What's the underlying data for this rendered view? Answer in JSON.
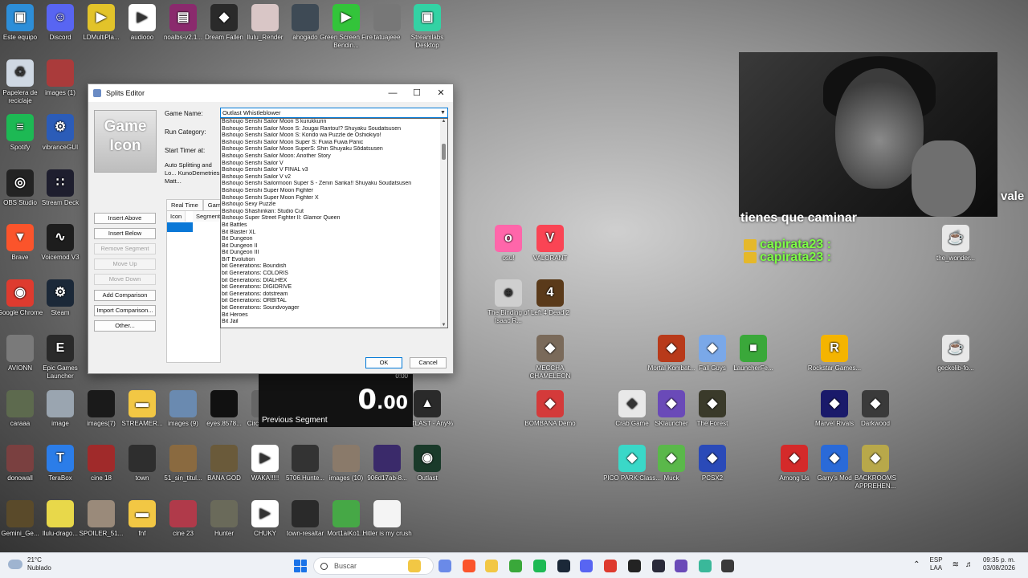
{
  "desktop_icons": [
    {
      "label": "Este equipo",
      "icon": "computer-icon",
      "color": "#2d8ed8"
    },
    {
      "label": "Discord",
      "icon": "discord-icon",
      "color": "#5865f2"
    },
    {
      "label": "LDMultiPla...",
      "icon": "ldplayer-icon",
      "color": "#e2c32a"
    },
    {
      "label": "audiooo",
      "icon": "audio-icon",
      "color": "#ffffff"
    },
    {
      "label": "noalbs-v2.1...",
      "icon": "archive-icon",
      "color": "#8a2a6d"
    },
    {
      "label": "Dream Fallen",
      "icon": "game-icon",
      "color": "#2a2a2a"
    },
    {
      "label": "llulu_Render",
      "icon": "image-icon",
      "color": "#d9c6c6"
    },
    {
      "label": "ahogado",
      "icon": "image-icon",
      "color": "#3e4a55"
    },
    {
      "label": "Green Screen Fire Bendin...",
      "icon": "video-icon",
      "color": "#33c43a"
    },
    {
      "label": "tatuajeee",
      "icon": "image-icon",
      "color": "#777777"
    },
    {
      "label": "Streamlabs Desktop",
      "icon": "streamlabs-icon",
      "color": "#33d2a4"
    },
    {
      "label": "Papelera de reciclaje",
      "icon": "recycle-bin-icon",
      "color": "#cfd8e3"
    },
    {
      "label": "images (1)",
      "icon": "image-icon",
      "color": "#aa3b3b"
    },
    {
      "label": "Spotify",
      "icon": "spotify-icon",
      "color": "#1db954"
    },
    {
      "label": "vibranceGUI",
      "icon": "gear-icon",
      "color": "#2b5cb8"
    },
    {
      "label": "OBS Studio",
      "icon": "obs-icon",
      "color": "#232323"
    },
    {
      "label": "Stream Deck",
      "icon": "streamdeck-icon",
      "color": "#1e1e2e"
    },
    {
      "label": "Brave",
      "icon": "brave-icon",
      "color": "#fb542b"
    },
    {
      "label": "Voicemod V3",
      "icon": "voicemod-icon",
      "color": "#1d1d1d"
    },
    {
      "label": "Google Chrome",
      "icon": "chrome-icon",
      "color": "#de3b2f"
    },
    {
      "label": "Steam",
      "icon": "steam-icon",
      "color": "#1b2838"
    },
    {
      "label": "AVIONN",
      "icon": "image-icon",
      "color": "#7a7a7a"
    },
    {
      "label": "Epic Games Launcher",
      "icon": "epic-icon",
      "color": "#2a2a2a"
    },
    {
      "label": "caraaa",
      "icon": "image-icon",
      "color": "#5d6a4e"
    },
    {
      "label": "image",
      "icon": "image-icon",
      "color": "#9aa5b0"
    },
    {
      "label": "images(7)",
      "icon": "image-icon",
      "color": "#1a1a1a"
    },
    {
      "label": "STREAMER...",
      "icon": "folder-icon",
      "color": "#f2c744"
    },
    {
      "label": "images (9)",
      "icon": "image-icon",
      "color": "#6a8ab0"
    },
    {
      "label": "eyes.8578...",
      "icon": "image-icon",
      "color": "#111111"
    },
    {
      "label": "donowall",
      "icon": "image-icon",
      "color": "#7a4040"
    },
    {
      "label": "TeraBox",
      "icon": "terabox-icon",
      "color": "#2b7de9"
    },
    {
      "label": "cine 18",
      "icon": "image-icon",
      "color": "#a02a2a"
    },
    {
      "label": "town",
      "icon": "image-icon",
      "color": "#2e2e2e"
    },
    {
      "label": "51_sin_titul...",
      "icon": "image-icon",
      "color": "#8a6a40"
    },
    {
      "label": "BANA GOD",
      "icon": "image-icon",
      "color": "#6a5a3a"
    },
    {
      "label": "WAKA!!!!!",
      "icon": "audio-icon",
      "color": "#ffffff"
    },
    {
      "label": "5706.Hunte...",
      "icon": "image-icon",
      "color": "#333333"
    },
    {
      "label": "images (10)",
      "icon": "image-icon",
      "color": "#8a7a6a"
    },
    {
      "label": "906d17ab-8...",
      "icon": "image-icon",
      "color": "#3a2a6a"
    },
    {
      "label": "Outlast",
      "icon": "outlast-icon",
      "color": "#1a3a2a"
    },
    {
      "label": "Gemini_Ge...",
      "icon": "image-icon",
      "color": "#5a4a2a"
    },
    {
      "label": "llulu-drago...",
      "icon": "image-icon",
      "color": "#e8d84a"
    },
    {
      "label": "SPOILER_51...",
      "icon": "image-icon",
      "color": "#9a8a7a"
    },
    {
      "label": "fnf",
      "icon": "folder-icon",
      "color": "#f2c744"
    },
    {
      "label": "cine 23",
      "icon": "image-icon",
      "color": "#b03a4a"
    },
    {
      "label": "Hunter",
      "icon": "image-icon",
      "color": "#6a6a5a"
    },
    {
      "label": "CHUKY",
      "icon": "audio-icon",
      "color": "#ffffff"
    },
    {
      "label": "town-resaltar",
      "icon": "image-icon",
      "color": "#2a2a2a"
    },
    {
      "label": "Mort1aiKo1...",
      "icon": "image-icon",
      "color": "#46a846"
    },
    {
      "label": "Hitler is my crush",
      "icon": "image-icon",
      "color": "#f4f4f4"
    },
    {
      "label": "OUTLAST - Any%",
      "icon": "livesplit-icon",
      "color": "#2a2a2a"
    },
    {
      "label": "Circulation...",
      "icon": "image-icon",
      "color": "#666666"
    },
    {
      "label": "osu!",
      "icon": "osu-icon",
      "color": "#ff66aa"
    },
    {
      "label": "VALORANT",
      "icon": "valorant-icon",
      "color": "#fa4454"
    },
    {
      "label": "The Binding of Isaac R...",
      "icon": "isaac-icon",
      "color": "#cfcfcf"
    },
    {
      "label": "Left 4 Dead 2",
      "icon": "l4d2-icon",
      "color": "#5a3a1a"
    },
    {
      "label": "MECCHA CHAMELEON",
      "icon": "game-icon",
      "color": "#7a6a5a"
    },
    {
      "label": "BOMBAÑA Demo",
      "icon": "game-icon",
      "color": "#d43a3a"
    },
    {
      "label": "Mortal Kombat...",
      "icon": "game-icon",
      "color": "#b83a1a"
    },
    {
      "label": "Fall Guys",
      "icon": "game-icon",
      "color": "#7aa8e8"
    },
    {
      "label": "LauncherFe...",
      "icon": "minecraft-icon",
      "color": "#3aa83a"
    },
    {
      "label": "Rockstar Games...",
      "icon": "rockstar-icon",
      "color": "#f4b400"
    },
    {
      "label": "Crab Game",
      "icon": "game-icon",
      "color": "#e8e8e8"
    },
    {
      "label": "SKlauncher",
      "icon": "game-icon",
      "color": "#6a4ab8"
    },
    {
      "label": "The Forest",
      "icon": "game-icon",
      "color": "#3a3a2a"
    },
    {
      "label": "Marvel Rivals",
      "icon": "game-icon",
      "color": "#1a1a6a"
    },
    {
      "label": "Darkwood",
      "icon": "game-icon",
      "color": "#3a3a3a"
    },
    {
      "label": "PICO PARK:Class...",
      "icon": "game-icon",
      "color": "#3ad8c8"
    },
    {
      "label": "Muck",
      "icon": "game-icon",
      "color": "#5ab84a"
    },
    {
      "label": "PCSX2",
      "icon": "game-icon",
      "color": "#2a4ab8"
    },
    {
      "label": "Among Us",
      "icon": "game-icon",
      "color": "#d42a2a"
    },
    {
      "label": "Garry's Mod",
      "icon": "game-icon",
      "color": "#2a6ad8"
    },
    {
      "label": "BACKROOMS APPREHEN...",
      "icon": "game-icon",
      "color": "#b8a84a"
    },
    {
      "label": "the_wonder...",
      "icon": "java-icon",
      "color": "#e8e8e8"
    },
    {
      "label": "geckolib-fo...",
      "icon": "java-icon",
      "color": "#e8e8e8"
    }
  ],
  "stream_overlay": {
    "side_text": "vale",
    "chat_line": "tienes que caminar",
    "chat_user": "capirata23 :",
    "livesplit_small": "0:00",
    "livesplit_timer_main": "0",
    "livesplit_timer_frac": ".00",
    "previous_segment_label": "Previous Segment"
  },
  "splits_editor": {
    "title": "Splits Editor",
    "game_icon_text": "Game Icon",
    "labels": {
      "game_name": "Game Name:",
      "run_category": "Run Category:",
      "start_timer_at": "Start Timer at:",
      "auto_splitting": "Auto Splitting and Lo... KunoDemetries, Matt..."
    },
    "game_name_value": "Outlast Whistleblower",
    "side_buttons": [
      {
        "label": "Insert Above",
        "enabled": true
      },
      {
        "label": "Insert Below",
        "enabled": true
      },
      {
        "label": "Remove Segment",
        "enabled": false
      },
      {
        "label": "Move Up",
        "enabled": false
      },
      {
        "label": "Move Down",
        "enabled": false
      },
      {
        "label": "Add Comparison",
        "enabled": true
      },
      {
        "label": "Import Comparison...",
        "enabled": true
      },
      {
        "label": "Other...",
        "enabled": true
      }
    ],
    "tabs": [
      "Real Time",
      "Game"
    ],
    "grid_columns": [
      "Icon",
      "Segment"
    ],
    "dropdown_items": [
      "Bishoujo Senshi Sailor Moon S kurukkurin",
      "Bishoujo Senshi Sailor Moon S: Jougai Rantou!? Shuyaku Soudatsusen",
      "Bishoujo Senshi Sailor Moon S: Kondo wa Puzzle de Oshiokiyo!",
      "Bishoujo Senshi Sailor Moon Super S: Fuwa Fuwa Panic",
      "Bishoujo Senshi Sailor Moon SuperS: Shin Shuyaku Sōdatsusen",
      "Bishoujo Senshi Sailor Moon: Another Story",
      "Bishoujo Senshi Sailor V",
      "Bishoujo Senshi Sailor V FINAL v3",
      "Bishoujo Senshi Sailor V v2",
      "Bishoujo Senshi Sailormoon Super S - Zenin Sanka!! Shuyaku Soudatsusen",
      "Bishoujo Senshi Super Moon Fighter",
      "Bishoujo Senshi Super Moon Fighter X",
      "Bishoujo Sexy Puzzle",
      "Bishoujo Shashinkan: Studio Cut",
      "Bishoujo Super Street Fighter II: Glamor Queen",
      "Bit Battles",
      "Bit Blaster XL",
      "Bit Dungeon",
      "Bit Dungeon II",
      "Bit Dungeon III",
      "BiT Evolution",
      "bit Generations: Boundish",
      "bit Generations: COLORIS",
      "bit Generations: DIALHEX",
      "bit Generations: DIGIDRIVE",
      "bit Generations: dotstream",
      "bit Generations: ORBITAL",
      "bit Generations: Soundvoyager",
      "Bit Heroes",
      "Bit Jail"
    ],
    "ok_label": "OK",
    "cancel_label": "Cancel"
  },
  "taskbar": {
    "weather_temp": "21°C",
    "weather_desc": "Nublado",
    "search_placeholder": "Buscar",
    "lang_top": "ESP",
    "lang_bottom": "LAA",
    "time": "09:35 p. m.",
    "date": "03/08/2026",
    "apps": [
      {
        "icon": "file-explorer-icon",
        "color": "#f2c744"
      },
      {
        "icon": "copilot-icon",
        "color": "#6a8ae8"
      },
      {
        "icon": "brave-icon",
        "color": "#fb542b"
      },
      {
        "icon": "folder-icon",
        "color": "#f2c744"
      },
      {
        "icon": "minecraft-icon",
        "color": "#3aa83a"
      },
      {
        "icon": "spotify-icon",
        "color": "#1db954"
      },
      {
        "icon": "steam-icon",
        "color": "#1b2838"
      },
      {
        "icon": "discord-icon",
        "color": "#5865f2"
      },
      {
        "icon": "chrome-icon",
        "color": "#de3b2f"
      },
      {
        "icon": "obs-icon",
        "color": "#232323"
      },
      {
        "icon": "app-icon",
        "color": "#2a2a3a"
      },
      {
        "icon": "app-icon",
        "color": "#6a4ab8"
      },
      {
        "icon": "app-icon",
        "color": "#3ab89a"
      },
      {
        "icon": "livesplit-icon",
        "color": "#3a3a3a"
      }
    ]
  }
}
